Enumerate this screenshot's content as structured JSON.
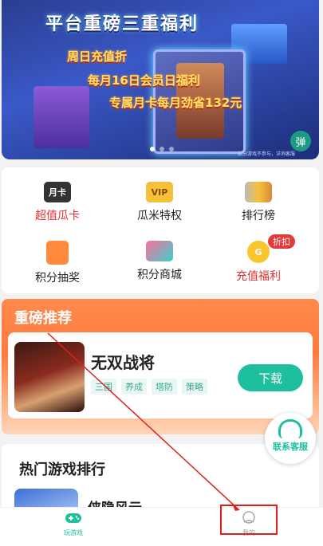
{
  "banner": {
    "title": "平台重磅三重福利",
    "line1": "周日充值折",
    "line2": "每月16日会员日福利",
    "line3": "专属月卡每月劲省132元",
    "disclaimer": "部分游戏不参与，详询客服",
    "danmu_label": "弹",
    "dots": 3,
    "active_dot": 0
  },
  "menu": {
    "items": [
      {
        "label": "超值瓜卡",
        "icon": "month-card-icon",
        "icon_text": "月卡"
      },
      {
        "label": "瓜米特权",
        "icon": "vip-crown-icon",
        "icon_text": "VIP"
      },
      {
        "label": "排行榜",
        "icon": "trophy-icon",
        "icon_text": ""
      },
      {
        "label": "积分抽奖",
        "icon": "lottery-icon",
        "icon_text": ""
      },
      {
        "label": "积分商城",
        "icon": "shop-bag-icon",
        "icon_text": ""
      },
      {
        "label": "充值福利",
        "icon": "gold-coin-icon",
        "icon_text": "G",
        "badge": "折扣"
      }
    ]
  },
  "recommend": {
    "title": "重磅推荐",
    "game_name": "无双战将",
    "tags": [
      "三国",
      "养成",
      "塔防",
      "策略"
    ],
    "download_label": "下载"
  },
  "service": {
    "label": "联系客服"
  },
  "hot": {
    "title": "热门游戏排行",
    "first_game": "侠隐风云"
  },
  "nav": {
    "games_label": "玩游戏",
    "mine_label": "我的"
  },
  "colors": {
    "accent": "#1dbf9e",
    "recommend": "#ff7a3e",
    "highlight": "#e02020"
  }
}
